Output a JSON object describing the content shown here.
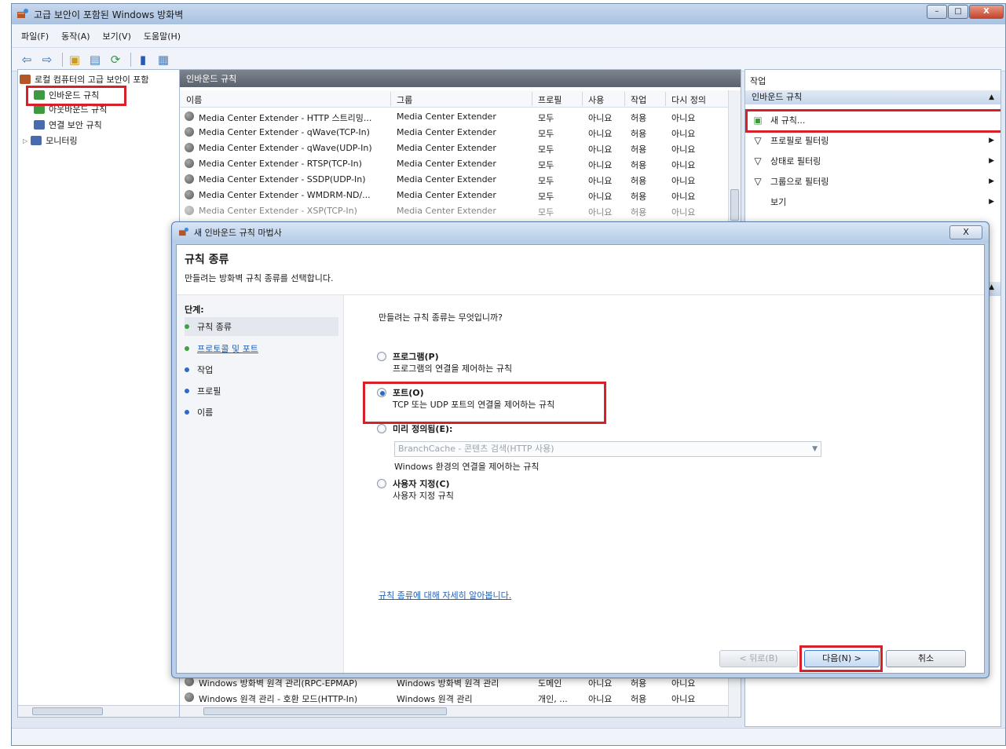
{
  "window": {
    "title": "고급 보안이 포함된 Windows 방화벽",
    "controls": {
      "minimize": "–",
      "maximize": "□",
      "close": "X"
    }
  },
  "menubar": {
    "items": [
      "파일(F)",
      "동작(A)",
      "보기(V)",
      "도움말(H)"
    ]
  },
  "toolbar": {
    "icons": [
      "back-arrow-icon",
      "forward-arrow-icon",
      "up-folder-icon",
      "properties-icon",
      "refresh-icon",
      "help-icon",
      "console-icon"
    ]
  },
  "tree": {
    "root": "로컬 컴퓨터의 고급 보안이 포함",
    "items": [
      "인바운드 규칙",
      "아웃바운드 규칙",
      "연결 보안 규칙",
      "모니터링"
    ]
  },
  "list": {
    "header": "인바운드 규칙",
    "columns": [
      "이름",
      "그룹",
      "프로필",
      "사용",
      "작업",
      "다시 정의"
    ],
    "rows": [
      [
        "Media Center Extender - HTTP 스트리밍...",
        "Media Center Extender",
        "모두",
        "아니요",
        "허용",
        "아니요"
      ],
      [
        "Media Center Extender - qWave(TCP-In)",
        "Media Center Extender",
        "모두",
        "아니요",
        "허용",
        "아니요"
      ],
      [
        "Media Center Extender - qWave(UDP-In)",
        "Media Center Extender",
        "모두",
        "아니요",
        "허용",
        "아니요"
      ],
      [
        "Media Center Extender - RTSP(TCP-In)",
        "Media Center Extender",
        "모두",
        "아니요",
        "허용",
        "아니요"
      ],
      [
        "Media Center Extender - SSDP(UDP-In)",
        "Media Center Extender",
        "모두",
        "아니요",
        "허용",
        "아니요"
      ],
      [
        "Media Center Extender - WMDRM-ND/...",
        "Media Center Extender",
        "모두",
        "아니요",
        "허용",
        "아니요"
      ],
      [
        "Media Center Extender - XSP(TCP-In)",
        "Media Center Extender",
        "모두",
        "아니요",
        "허용",
        "아니요"
      ]
    ],
    "bottom_rows": [
      [
        "Windows 방화벽 원격 관리(RPC-EPMAP)",
        "Windows 방화벽 원격 관리",
        "도메인",
        "아니요",
        "허용",
        "아니요"
      ],
      [
        "Windows 원격 관리 - 호환 모드(HTTP-In)",
        "Windows 원격 관리",
        "개인, ...",
        "아니요",
        "허용",
        "아니요"
      ]
    ]
  },
  "actions": {
    "title": "작업",
    "section": "인바운드 규칙",
    "items": [
      {
        "label": "새 규칙...",
        "icon": "new-rule-icon",
        "submenu": false
      },
      {
        "label": "프로필로 필터링",
        "icon": "filter-icon",
        "submenu": true
      },
      {
        "label": "상태로 필터링",
        "icon": "filter-icon",
        "submenu": true
      },
      {
        "label": "그룹으로 필터링",
        "icon": "filter-icon",
        "submenu": true
      },
      {
        "label": "보기",
        "icon": "",
        "submenu": true
      }
    ]
  },
  "wizard": {
    "title": "새 인바운드 규칙 마법사",
    "close_label": "X",
    "heading": "규칙 종류",
    "subheading": "만들려는 방화벽 규칙 종류를 선택합니다.",
    "steps_title": "단계:",
    "steps": [
      "규칙 종류",
      "프로토콜 및 포트",
      "작업",
      "프로필",
      "이름"
    ],
    "question": "만들려는 규칙 종류는 무엇입니까?",
    "options": [
      {
        "label": "프로그램(P)",
        "desc": "프로그램의 연결을 제어하는 규칙"
      },
      {
        "label": "포트(O)",
        "desc": "TCP 또는 UDP 포트의 연결을 제어하는 규칙"
      },
      {
        "label": "미리 정의됨(E):",
        "desc": "Windows 환경의 연결을 제어하는 규칙"
      },
      {
        "label": "사용자 지정(C)",
        "desc": "사용자 지정 규칙"
      }
    ],
    "predefined_value": "BranchCache - 콘텐츠 검색(HTTP 사용)",
    "learn_more": "규칙 종류에 대해 자세히 알아봅니다.",
    "buttons": {
      "back": "< 뒤로(B)",
      "next": "다음(N) >",
      "cancel": "취소"
    }
  },
  "colors": {
    "highlight": "#d8202a",
    "link": "#1f5fb8",
    "selected_radio": "#2c6ac4"
  }
}
